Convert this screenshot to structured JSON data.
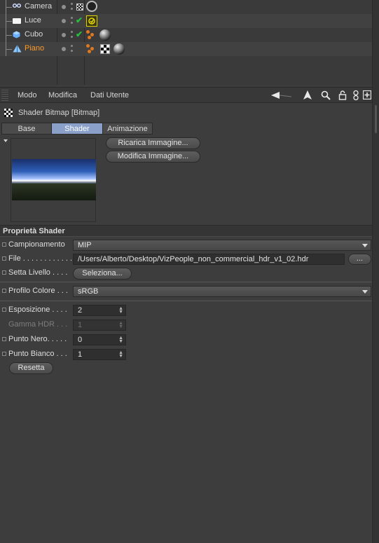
{
  "object_manager": {
    "objects": [
      {
        "name": "Camera",
        "selected": false,
        "icon": "camera-object-icon",
        "tags": [
          "camera-tag-icon"
        ]
      },
      {
        "name": "Luce",
        "selected": false,
        "icon": "light-object-icon",
        "tags": [
          "light-tag-icon"
        ]
      },
      {
        "name": "Cubo",
        "selected": false,
        "icon": "cube-object-icon",
        "tags": [
          "material-tag-icon"
        ]
      },
      {
        "name": "Piano",
        "selected": true,
        "icon": "plane-object-icon",
        "tags": [
          "material-tag-icon",
          "checker-tag-icon",
          "material-tag-icon"
        ]
      }
    ]
  },
  "attribute_manager": {
    "menu": [
      "Modo",
      "Modifica",
      "Dati Utente"
    ],
    "title": "Shader Bitmap [Bitmap]",
    "tabs": [
      "Base",
      "Shader",
      "Animazione"
    ],
    "active_tab": "Shader",
    "buttons": {
      "reload": "Ricarica Immagine...",
      "edit": "Modifica Immagine..."
    },
    "section_title": "Proprietà Shader",
    "properties": {
      "sampling": {
        "label": "Campionamento",
        "value": "MIP"
      },
      "file": {
        "label": "File . . . . . . . . . . . .",
        "value": "/Users/Alberto/Desktop/VizPeople_non_commercial_hdr_v1_02.hdr",
        "browse": "..."
      },
      "layer": {
        "label": "Setta Livello . . . .",
        "button": "Seleziona..."
      },
      "color_profile": {
        "label": "Profilo Colore . . .",
        "value": "sRGB"
      },
      "exposure": {
        "label": "Esposizione . . . .",
        "value": "2"
      },
      "hdr_gamma": {
        "label": "Gamma HDR . . .",
        "value": "1"
      },
      "black_point": {
        "label": "Punto Nero. . . . .",
        "value": "0"
      },
      "white_point": {
        "label": "Punto Bianco . . .",
        "value": "1"
      }
    },
    "reset_button": "Resetta"
  },
  "colors": {
    "selected_object": "#ff9a28",
    "active_tab": "#8aa0c9",
    "check": "#27c23c"
  }
}
